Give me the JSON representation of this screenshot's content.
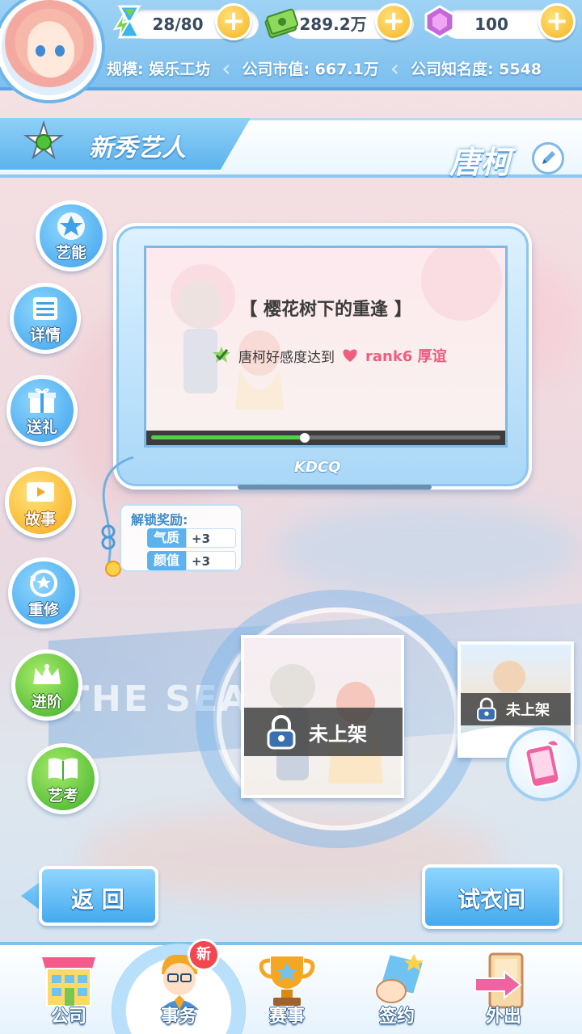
{
  "resources": {
    "energy": "28/80",
    "money": "289.2万",
    "gems": "100"
  },
  "company_stats": {
    "scale": "规模: 娱乐工坊",
    "market_value": "公司市值: 667.1万",
    "fame": "公司知名度: 5548"
  },
  "section": {
    "title": "新秀艺人",
    "artist_name": "唐柯"
  },
  "side_menu": [
    {
      "label": "艺能",
      "icon": "star-icon",
      "color": "blue"
    },
    {
      "label": "详情",
      "icon": "list-icon",
      "color": "blue"
    },
    {
      "label": "送礼",
      "icon": "gift-icon",
      "color": "blue"
    },
    {
      "label": "故事",
      "icon": "play-icon",
      "color": "orange"
    },
    {
      "label": "重修",
      "icon": "refresh-star-icon",
      "color": "blue"
    },
    {
      "label": "进阶",
      "icon": "crown-icon",
      "color": "green"
    },
    {
      "label": "艺考",
      "icon": "book-icon",
      "color": "green"
    }
  ],
  "story": {
    "title": "【 樱花树下的重逢 】",
    "requirement": "唐柯好感度达到",
    "rank": "rank6 厚谊",
    "progress": 0.44,
    "tv_logo": "KDCQ"
  },
  "reward": {
    "title": "解锁奖励:",
    "items": [
      {
        "name": "气质",
        "value": "+3"
      },
      {
        "name": "颜值",
        "value": "+3"
      }
    ]
  },
  "cards": {
    "main_status": "未上架",
    "side_status": "未上架"
  },
  "buttons": {
    "back": "返 回",
    "fitting_room": "试衣间"
  },
  "bottom_nav": [
    {
      "label": "公司",
      "icon": "building-icon"
    },
    {
      "label": "事务",
      "icon": "manager-icon",
      "badge": "新"
    },
    {
      "label": "赛事",
      "icon": "trophy-icon"
    },
    {
      "label": "签约",
      "icon": "contract-icon"
    },
    {
      "label": "外出",
      "icon": "door-icon"
    }
  ],
  "background_text": "THE SEAS"
}
